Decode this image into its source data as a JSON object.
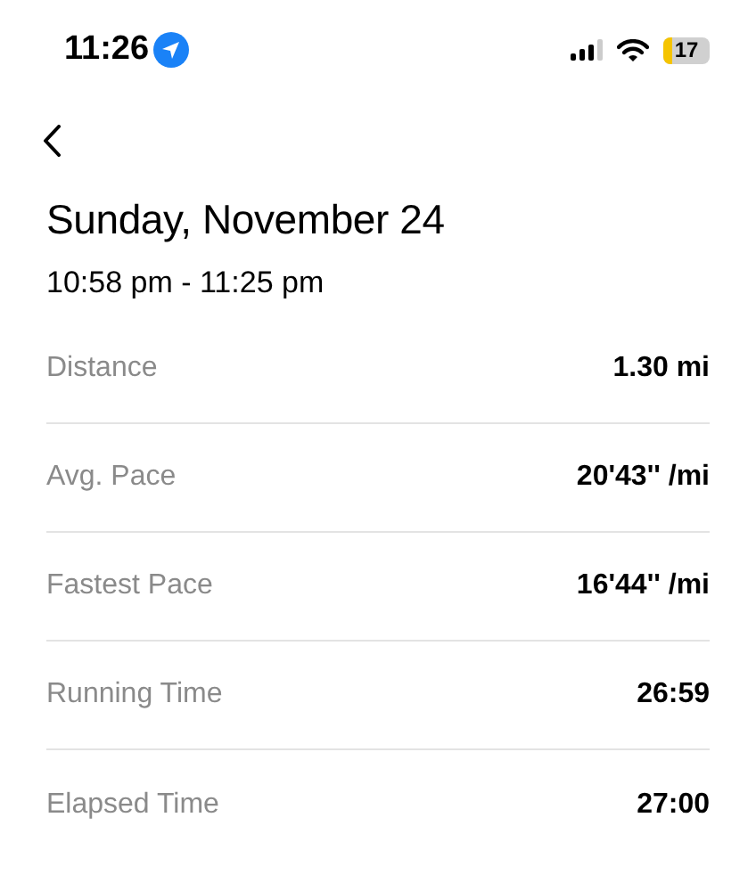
{
  "status_bar": {
    "time": "11:26",
    "battery": "17"
  },
  "title": "Sunday, November 24",
  "time_range": "10:58 pm - 11:25 pm",
  "stats": [
    {
      "label": "Distance",
      "value": "1.30 mi"
    },
    {
      "label": "Avg. Pace",
      "value": "20'43'' /mi"
    },
    {
      "label": "Fastest Pace",
      "value": "16'44'' /mi"
    },
    {
      "label": "Running Time",
      "value": "26:59"
    },
    {
      "label": "Elapsed Time",
      "value": "27:00"
    }
  ]
}
